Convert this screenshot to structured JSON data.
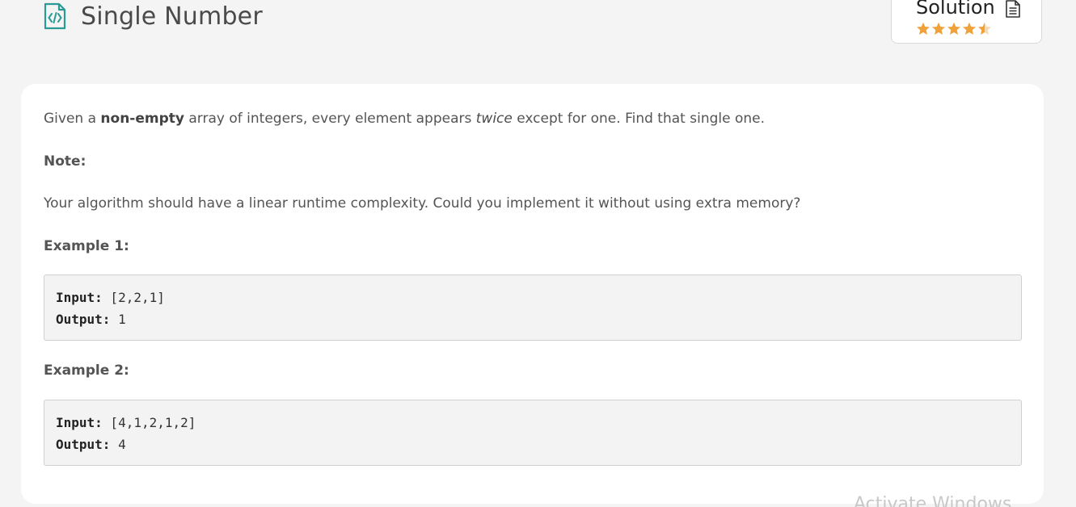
{
  "header": {
    "title": "Single Number",
    "icon": "code-file-icon",
    "accent_color": "#2b9a95"
  },
  "solution": {
    "label": "Solution",
    "icon": "document-icon",
    "rating": 4.5,
    "rating_max": 5,
    "star_color": "#f0a23a"
  },
  "problem": {
    "description": {
      "part1": "Given a ",
      "bold": "non-empty",
      "part2": " array of integers, every element appears ",
      "italic": "twice",
      "part3": " except for one. Find that single one."
    },
    "note_heading": "Note:",
    "note_text": "Your algorithm should have a linear runtime complexity. Could you implement it without using extra memory?",
    "examples": [
      {
        "heading": "Example 1:",
        "input_label": "Input:",
        "input_value": " [2,2,1]",
        "output_label": "Output:",
        "output_value": " 1"
      },
      {
        "heading": "Example 2:",
        "input_label": "Input:",
        "input_value": " [4,1,2,1,2]",
        "output_label": "Output:",
        "output_value": " 4"
      }
    ]
  },
  "watermark": "Activate Windows"
}
